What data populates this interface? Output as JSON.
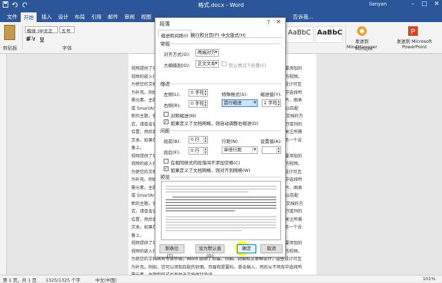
{
  "window": {
    "title": "格式.docx - Word",
    "user": "lianyan"
  },
  "ribbon_tabs": [
    "文件",
    "开始",
    "插入",
    "设计",
    "布局",
    "引用",
    "邮件",
    "审阅",
    "视图",
    "告诉我..."
  ],
  "ribbon": {
    "paste_label": "剪贴板",
    "font_name": "楷体 (中文正文)",
    "font_size": "五号",
    "font_group_label": "字体",
    "style_previews": [
      "AaBbC",
      "AaBbC"
    ],
    "addins": [
      {
        "label": "发送到 MindManager",
        "group": "Mindjet"
      },
      {
        "label": "发送到 Microsoft PowerPoint",
        "group": ""
      }
    ]
  },
  "dialog": {
    "title": "段落",
    "help": "?",
    "close": "×",
    "tabs": [
      "缩进和间距(I)",
      "换行和分页(P)",
      "中文版式(H)"
    ],
    "general": {
      "heading": "常规",
      "alignment_label": "对齐方式(G):",
      "alignment_value": "两端对齐",
      "outline_label": "大纲级别(O):",
      "outline_value": "正文文本",
      "collapsed_label": "默认情况下折叠(E)"
    },
    "indent": {
      "heading": "缩进",
      "left_label": "左侧(L):",
      "left_value": "0 字符",
      "right_label": "右侧(R):",
      "right_value": "0 字符",
      "special_label": "特殊格式(S):",
      "special_value": "首行缩进",
      "by_label": "缩进值(Y):",
      "by_value": "2 字符",
      "mirror_label": "对称缩进(M)",
      "auto_adjust_label": "如果定义了文档网格，则自动调整右缩进(D)"
    },
    "spacing": {
      "heading": "间距",
      "before_label": "段前(B):",
      "before_value": "0 行",
      "after_label": "段后(F):",
      "after_value": "0 行",
      "line_label": "行距(N):",
      "line_value": "单倍行距",
      "at_label": "设置值(A):",
      "no_space_label": "在相同样式的段落间不添加空格(C)",
      "snap_grid_label": "如果定义了文档网格，则对齐到网格(W)"
    },
    "preview": {
      "heading": "预览"
    },
    "buttons": {
      "tabs": "制表位(T)...",
      "set_default": "设为默认值(D)",
      "ok": "确定",
      "cancel": "取消"
    }
  },
  "document_text": [
    "视频提供了功能强大的方法帮助您证明您的观点。当您单击联机视频时，可以在想要添加的",
    "视频的嵌入代码中进行粘贴。您也可以键入一个关键字以联机搜索最适合您的文档的视频。",
    "为使您的文档具有专业外观，Word 提供了页眉、页脚、封面和文本框设计，这些设计可互",
    "为补充。例如，您可以添加匹配的封面、页眉和提要栏。单击插入，然后从不同库中选择所",
    "需元素。主题和样式也有助于文档保持协调。当您单击设计并选择新的主题时，图片、图表",
    "或 SmartArt 图形将会更改以匹配新的主题。当应用样式时，您的标题会进行更改以匹配",
    "新的主题。使用在需要位置出现的新按钮在 Word 中节省时间。若要更改图片适应文档的方",
    "式，请单击该图片，图片旁边将会显示布局选项按钮。当处理表格时，单击要添加行或列的",
    "位置，然后单击加号。在新的阅读视图中阅读更加容易。可以折叠文档某些部分并关注所需",
    "文本。如果在达到结尾处之前需要停止读取，Word 会记住您的停止位置，即使在另一个设",
    "备上。",
    "视频提供了功能强大的方法帮助您证明您的观点。当您单击联机视频时，可以在想要添加的",
    "视频的嵌入代码中进行粘贴。您也可以键入一个关键字以联机搜索最适合您的文档的视频。",
    "为使您的文档具有专业外观，Word 提供了页眉、页脚、封面和文本框设计，这些设计可互",
    "为补充。例如，您可以添加匹配的封面、页眉和提要栏。单击插入，然后从不同库中选择所",
    "需元素。主题和样式也有助于文档保持协调。当您单击设计并选择新的主题时，图片、图表",
    "或 SmartArt 图形将会更改以匹配新的主题。当应用样式时，您的标题会进行更改以匹配",
    "新的主题。使用在需要位置出现的新按钮在 Word 中节省时间。若要更改图片适应文档的方",
    "式，请单击该图片，图片旁边将会显示布局选项按钮。当处理表格时，单击要添加行或列的",
    "位置，然后单击加号。在新的阅读视图中阅读更加容易。可以折叠文档某些部分并关注所需",
    "文本。如果在达到结尾处之前需要停止读取，Word 会记住您的停止位置，即使在另一个设",
    "备上。",
    "视频提供了功能强大的方法帮助您证明您的观点。当您单击联机视频时，可以在想要添加的",
    "视频的嵌入代码中进行粘贴。您也可以键入一个关键字以联机搜索最适合您的文档的视频。",
    "为使您的文档具有专业外观，Word 提供了页眉、页脚、封面和文本框设计，这些设计可互",
    "为补充。例如，您可以添加匹配的封面、页眉和提要栏。单击插入，然后从不同库中选择所",
    "需元素。主题和样式也有助于文档保持协调。"
  ],
  "status": {
    "page": "第 1 页，共 1 页",
    "words": "1325/1325 个字",
    "language": "中文(中国)",
    "zoom": "101%"
  },
  "colors": {
    "accent": "#2b579a",
    "highlight": "#cce4f7",
    "cursor": "#ffff00"
  }
}
